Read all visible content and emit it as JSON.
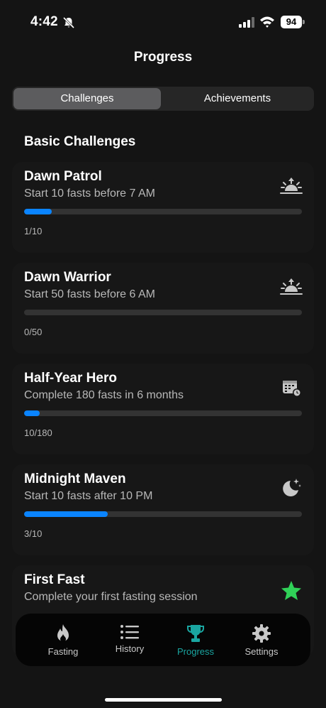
{
  "status_bar": {
    "time": "4:42",
    "battery": "94"
  },
  "header": {
    "title": "Progress"
  },
  "segments": {
    "active": "Challenges",
    "inactive": "Achievements"
  },
  "section": {
    "title": "Basic Challenges"
  },
  "challenges": [
    {
      "title": "Dawn Patrol",
      "description": "Start 10 fasts before 7 AM",
      "count": "1/10",
      "progress": 0.1,
      "icon": "sunrise-icon"
    },
    {
      "title": "Dawn Warrior",
      "description": "Start 50 fasts before 6 AM",
      "count": "0/50",
      "progress": 0.0,
      "icon": "sunrise-icon"
    },
    {
      "title": "Half-Year Hero",
      "description": "Complete 180 fasts in 6 months",
      "count": "10/180",
      "progress": 0.0556,
      "icon": "calendar-clock-icon"
    },
    {
      "title": "Midnight Maven",
      "description": "Start 10 fasts after 10 PM",
      "count": "3/10",
      "progress": 0.3,
      "icon": "moon-stars-icon"
    },
    {
      "title": "First Fast",
      "description": "Complete your first fasting session",
      "icon": "star-icon"
    }
  ],
  "tabbar": {
    "fasting": "Fasting",
    "history": "History",
    "progress": "Progress",
    "settings": "Settings"
  },
  "colors": {
    "accent": "#0a84ff",
    "tab_active": "#1aa6a1",
    "star": "#30d158"
  }
}
